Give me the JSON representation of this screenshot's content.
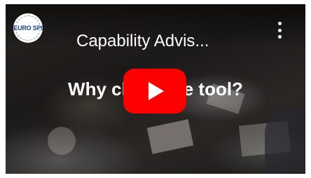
{
  "video": {
    "channel_logo_text": "EURO SPI",
    "title": "Capability Advis...",
    "headline": "Why ch          e tool?",
    "icons": {
      "more": "more-vert-icon",
      "play": "youtube-play-icon"
    },
    "colors": {
      "play_red": "#ff0000",
      "logo_blue": "#1e3f8a"
    }
  }
}
